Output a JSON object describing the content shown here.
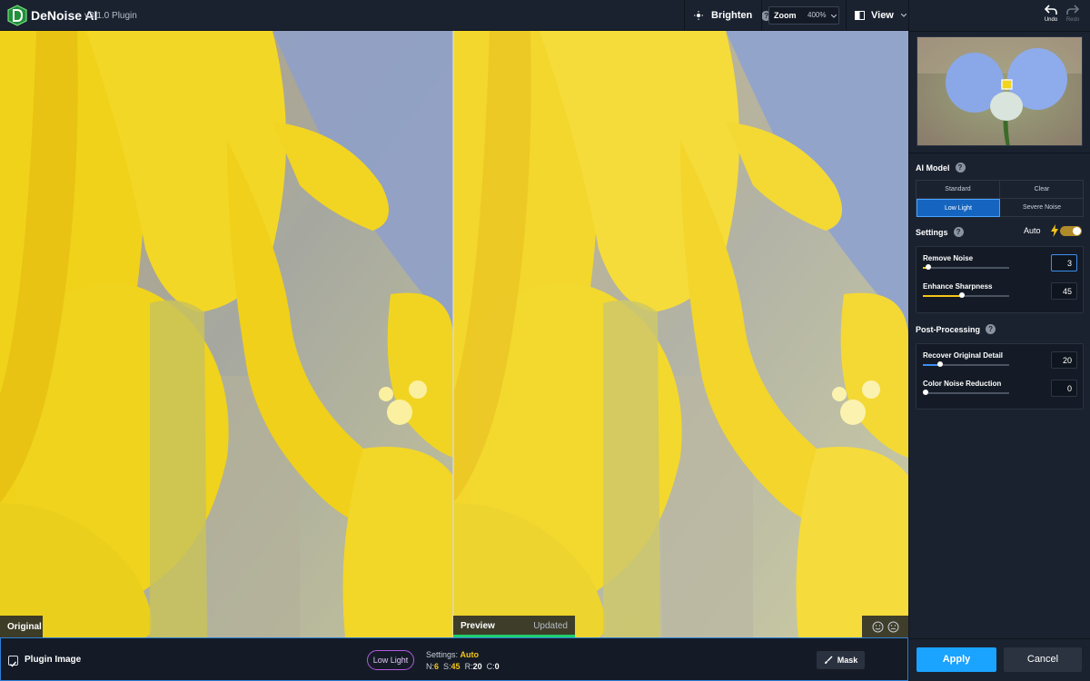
{
  "app": {
    "title": "DeNoise AI",
    "version": "v3.1.0 Plugin"
  },
  "toolbar": {
    "brighten_label": "Brighten",
    "zoom_label": "Zoom",
    "zoom_value": "400%",
    "view_label": "View"
  },
  "history": {
    "undo_label": "Undo",
    "redo_label": "Redo"
  },
  "viewer": {
    "original_label": "Original",
    "preview_label": "Preview",
    "preview_status": "Updated"
  },
  "bottom": {
    "plugin_image_label": "Plugin Image",
    "plugin_image_checked": true,
    "model_pill": "Low Light",
    "settings_label": "Settings:",
    "settings_mode": "Auto",
    "n_label": "N:",
    "n_value": "6",
    "s_label": "S:",
    "s_value": "45",
    "r_label": "R:",
    "r_value": "20",
    "c_label": "C:",
    "c_value": "0",
    "mask_label": "Mask"
  },
  "ai_model": {
    "title": "AI Model",
    "options": [
      "Standard",
      "Clear",
      "Low Light",
      "Severe Noise"
    ],
    "selected": "Low Light"
  },
  "settings": {
    "title": "Settings",
    "auto_label": "Auto",
    "auto_on": true,
    "remove_noise": {
      "label": "Remove Noise",
      "value": "3",
      "fraction": 0.06
    },
    "enhance_sharpness": {
      "label": "Enhance Sharpness",
      "value": "45",
      "fraction": 0.45
    }
  },
  "post_processing": {
    "title": "Post-Processing",
    "recover_detail": {
      "label": "Recover Original Detail",
      "value": "20",
      "fraction": 0.2
    },
    "color_noise": {
      "label": "Color Noise Reduction",
      "value": "0",
      "fraction": 0.0
    }
  },
  "actions": {
    "apply_label": "Apply",
    "cancel_label": "Cancel"
  },
  "colors": {
    "accent": "#1aa3ff",
    "slider_fill": "#f5c518",
    "preview_bar": "#1fcf6d",
    "model_active": "#1565c0"
  }
}
